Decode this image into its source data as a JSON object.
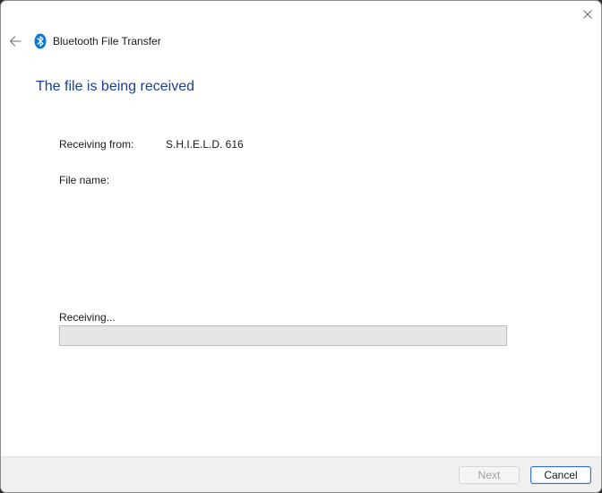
{
  "window": {
    "app_title": "Bluetooth File Transfer"
  },
  "main": {
    "heading": "The file is being received",
    "receiving_from_label": "Receiving from:",
    "receiving_from_value": "S.H.I.E.L.D. 616",
    "file_name_label": "File name:",
    "file_name_value": "",
    "status_label": "Receiving...",
    "progress": 0
  },
  "footer": {
    "next_label": "Next",
    "cancel_label": "Cancel"
  },
  "icons": {
    "close": "close-icon",
    "back": "back-arrow-icon",
    "app": "bluetooth-icon"
  },
  "colors": {
    "heading": "#1a3f9a",
    "bluetooth": "#0a78d4",
    "default_button_border": "#3d73c7",
    "progress_track": "#e6e6e6"
  }
}
